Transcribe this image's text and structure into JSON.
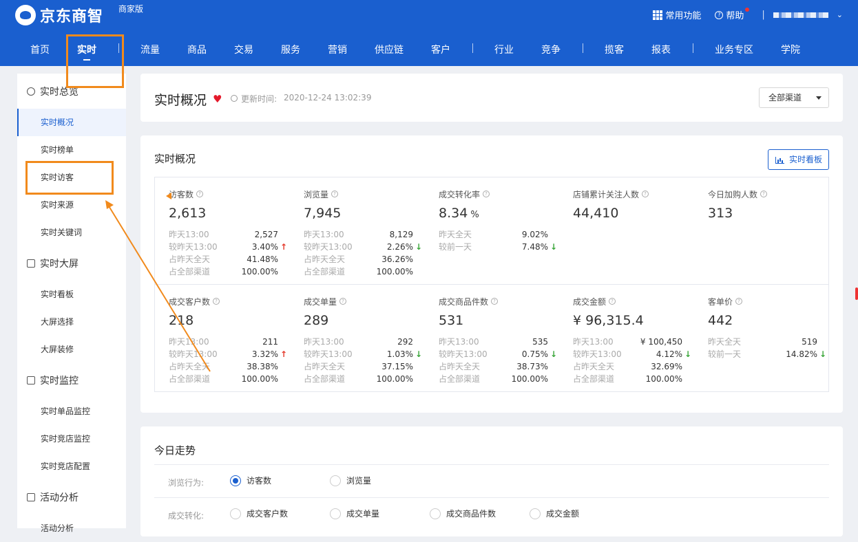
{
  "header": {
    "brand": "京东商智",
    "edition": "商家版",
    "common_functions": "常用功能",
    "help": "帮助",
    "separator": "|"
  },
  "nav": {
    "items": [
      "首页",
      "实时",
      "流量",
      "商品",
      "交易",
      "服务",
      "营销",
      "供应链",
      "客户",
      "行业",
      "竞争",
      "揽客",
      "报表",
      "业务专区",
      "学院"
    ],
    "active": "实时"
  },
  "sidebar": {
    "groups": [
      {
        "label": "实时总览",
        "items": [
          "实时概况",
          "实时榜单",
          "实时访客",
          "实时来源",
          "实时关键词"
        ]
      },
      {
        "label": "实时大屏",
        "items": [
          "实时看板",
          "大屏选择",
          "大屏装修"
        ]
      },
      {
        "label": "实时监控",
        "items": [
          "实时单品监控",
          "实时竞店监控",
          "实时竞店配置"
        ]
      },
      {
        "label": "活动分析",
        "items": [
          "活动分析"
        ]
      }
    ],
    "active_item": "实时概况"
  },
  "overview_header": {
    "title": "实时概况",
    "update_label": "更新时间:",
    "update_time": "2020-12-24 13:02:39",
    "channel": "全部渠道"
  },
  "overview": {
    "title": "实时概况",
    "board_button": "实时看板",
    "metrics": [
      {
        "label": "访客数",
        "value": "2,613",
        "rows": [
          {
            "l": "昨天13:00",
            "v": "2,527"
          },
          {
            "l": "较昨天13:00",
            "v": "3.40%",
            "trend": "up"
          },
          {
            "l": "占昨天全天",
            "v": "41.48%"
          },
          {
            "l": "占全部渠道",
            "v": "100.00%"
          }
        ]
      },
      {
        "label": "浏览量",
        "value": "7,945",
        "rows": [
          {
            "l": "昨天13:00",
            "v": "8,129"
          },
          {
            "l": "较昨天13:00",
            "v": "2.26%",
            "trend": "down"
          },
          {
            "l": "占昨天全天",
            "v": "36.26%"
          },
          {
            "l": "占全部渠道",
            "v": "100.00%"
          }
        ]
      },
      {
        "label": "成交转化率",
        "value": "8.34",
        "unit": "%",
        "rows": [
          {
            "l": "昨天全天",
            "v": "9.02%"
          },
          {
            "l": "较前一天",
            "v": "7.48%",
            "trend": "down"
          }
        ]
      },
      {
        "label": "店铺累计关注人数",
        "value": "44,410",
        "rows": []
      },
      {
        "label": "今日加购人数",
        "value": "313",
        "rows": []
      },
      {
        "label": "成交客户数",
        "value": "218",
        "rows": [
          {
            "l": "昨天13:00",
            "v": "211"
          },
          {
            "l": "较昨天13:00",
            "v": "3.32%",
            "trend": "up"
          },
          {
            "l": "占昨天全天",
            "v": "38.38%"
          },
          {
            "l": "占全部渠道",
            "v": "100.00%"
          }
        ]
      },
      {
        "label": "成交单量",
        "value": "289",
        "rows": [
          {
            "l": "昨天13:00",
            "v": "292"
          },
          {
            "l": "较昨天13:00",
            "v": "1.03%",
            "trend": "down"
          },
          {
            "l": "占昨天全天",
            "v": "37.15%"
          },
          {
            "l": "占全部渠道",
            "v": "100.00%"
          }
        ]
      },
      {
        "label": "成交商品件数",
        "value": "531",
        "rows": [
          {
            "l": "昨天13:00",
            "v": "535"
          },
          {
            "l": "较昨天13:00",
            "v": "0.75%",
            "trend": "down"
          },
          {
            "l": "占昨天全天",
            "v": "38.73%"
          },
          {
            "l": "占全部渠道",
            "v": "100.00%"
          }
        ]
      },
      {
        "label": "成交金额",
        "value": "¥ 96,315.4",
        "rows": [
          {
            "l": "昨天13:00",
            "v": "¥ 100,450"
          },
          {
            "l": "较昨天13:00",
            "v": "4.12%",
            "trend": "down"
          },
          {
            "l": "占昨天全天",
            "v": "32.69%"
          },
          {
            "l": "占全部渠道",
            "v": "100.00%"
          }
        ]
      },
      {
        "label": "客单价",
        "value": "442",
        "rows": [
          {
            "l": "昨天全天",
            "v": "519"
          },
          {
            "l": "较前一天",
            "v": "14.82%",
            "trend": "down"
          }
        ]
      }
    ]
  },
  "trend": {
    "title": "今日走势",
    "browse_label": "浏览行为:",
    "browse_options": [
      "访客数",
      "浏览量"
    ],
    "browse_selected": "访客数",
    "deal_label": "成交转化:",
    "deal_options": [
      "成交客户数",
      "成交单量",
      "成交商品件数",
      "成交金额"
    ]
  },
  "icons": {
    "trend_up": "↑",
    "trend_down": "↓",
    "heart": "♥",
    "question": "?"
  },
  "colors": {
    "brand": "#1a5fcf",
    "highlight": "#f18a1c",
    "up": "#e4392b",
    "down": "#3aa63a"
  }
}
